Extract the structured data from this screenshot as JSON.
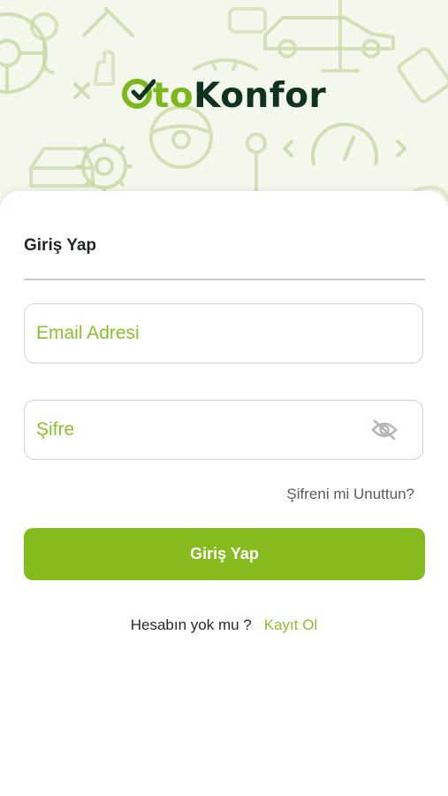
{
  "logo": {
    "check": "O",
    "part1": "to",
    "part2": "Konfor"
  },
  "login": {
    "tab_title": "Giriş Yap",
    "email_placeholder": "Email Adresi",
    "password_placeholder": "Şifre",
    "forgot_label": "Şifreni mi Unuttun?",
    "submit_label": "Giriş Yap",
    "no_account_label": "Hesabın yok mu ?",
    "register_label": "Kayıt Ol"
  },
  "colors": {
    "brand_green": "#85bb1c",
    "brand_dark": "#0f3320",
    "header_bg": "#f4f7ec"
  },
  "icons": [
    "steering-wheel-icon",
    "car-icon",
    "wrench-icon",
    "gear-icon",
    "speedometer-icon",
    "eye-off-icon",
    "checkmark-icon"
  ]
}
